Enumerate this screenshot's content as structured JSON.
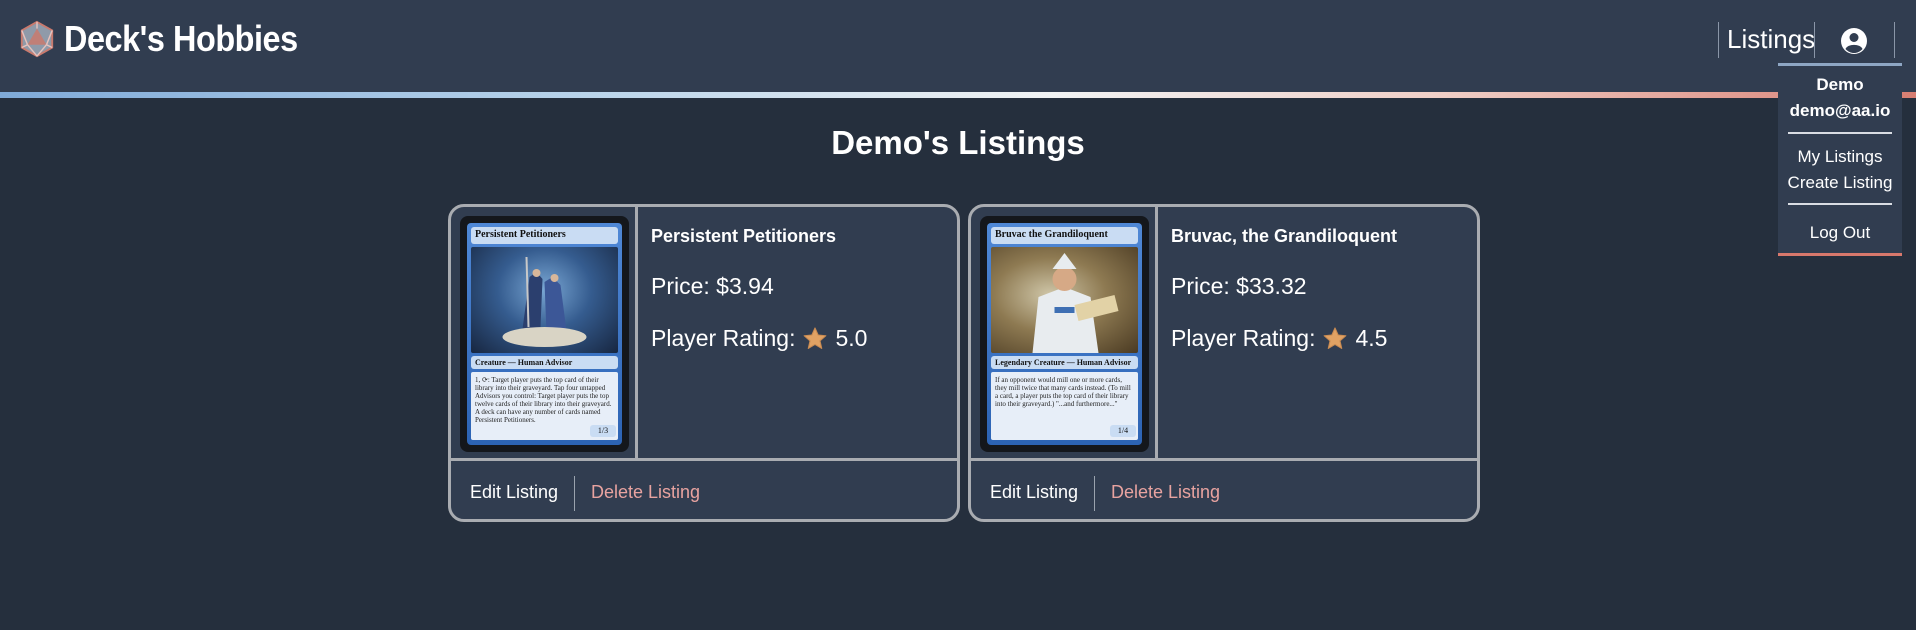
{
  "header": {
    "app_title": "Deck's Hobbies",
    "logo_icon": "d20-dice-icon",
    "nav_listings": "Listings",
    "user_icon": "user-circle-icon"
  },
  "dropdown": {
    "username": "Demo",
    "email": "demo@aa.io",
    "my_listings": "My Listings",
    "create_listing": "Create Listing",
    "logout": "Log Out"
  },
  "page": {
    "title": "Demo's Listings"
  },
  "listings": [
    {
      "name": "Persistent Petitioners",
      "price": "Price: $3.94",
      "rating_label": "Player Rating:",
      "rating": "5.0",
      "card_title": "Persistent Petitioners",
      "card_type": "Creature — Human Advisor",
      "card_text": "1, ⟳: Target player puts the top card of their library into their graveyard. Tap four untapped Advisors you control: Target player puts the top twelve cards of their library into their graveyard. A deck can have any number of cards named Persistent Petitioners.",
      "card_pt": "1/3",
      "edit_label": "Edit Listing",
      "delete_label": "Delete Listing"
    },
    {
      "name": "Bruvac, the Grandiloquent",
      "price": "Price: $33.32",
      "rating_label": "Player Rating:",
      "rating": "4.5",
      "card_title": "Bruvac the Grandiloquent",
      "card_type": "Legendary Creature — Human Advisor",
      "card_text": "If an opponent would mill one or more cards, they mill twice that many cards instead. (To mill a card, a player puts the top card of their library into their graveyard.) \"...and furthermore...\"",
      "card_pt": "1/4",
      "edit_label": "Edit Listing",
      "delete_label": "Delete Listing"
    }
  ],
  "colors": {
    "background": "#252f3d",
    "panel": "#313d50",
    "border": "#a9acb1",
    "delete_text": "#e8a3a0",
    "star": "#e0a264"
  }
}
